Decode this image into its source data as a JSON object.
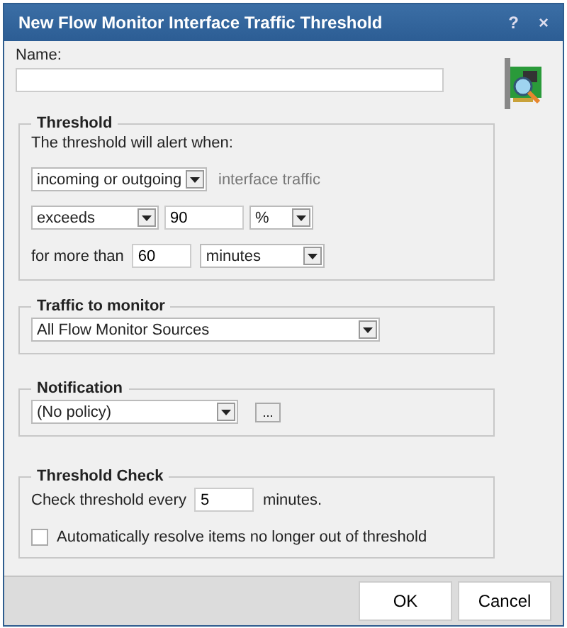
{
  "window": {
    "title": "New Flow Monitor Interface Traffic Threshold",
    "help": "?",
    "close": "×"
  },
  "name": {
    "label": "Name:"
  },
  "threshold": {
    "legend": "Threshold",
    "intro": "The threshold will alert when:",
    "direction": {
      "value": "incoming or outgoing"
    },
    "direction_suffix": "interface traffic",
    "comparison": {
      "value": "exceeds"
    },
    "amount": "90",
    "unit": {
      "value": "%"
    },
    "duration_label": "for more than",
    "duration": "60",
    "duration_unit": {
      "value": "minutes"
    }
  },
  "traffic": {
    "legend": "Traffic to monitor",
    "source": {
      "value": "All Flow Monitor Sources"
    }
  },
  "notification": {
    "legend": "Notification",
    "policy": {
      "value": "(No policy)"
    },
    "browse": "..."
  },
  "check": {
    "legend": "Threshold Check",
    "prefix": "Check threshold every",
    "interval": "5",
    "suffix": "minutes.",
    "auto_resolve": {
      "label": "Automatically resolve items no longer out of threshold",
      "checked": false
    }
  },
  "buttons": [
    {
      "label": "OK"
    },
    {
      "label": "Cancel"
    }
  ]
}
